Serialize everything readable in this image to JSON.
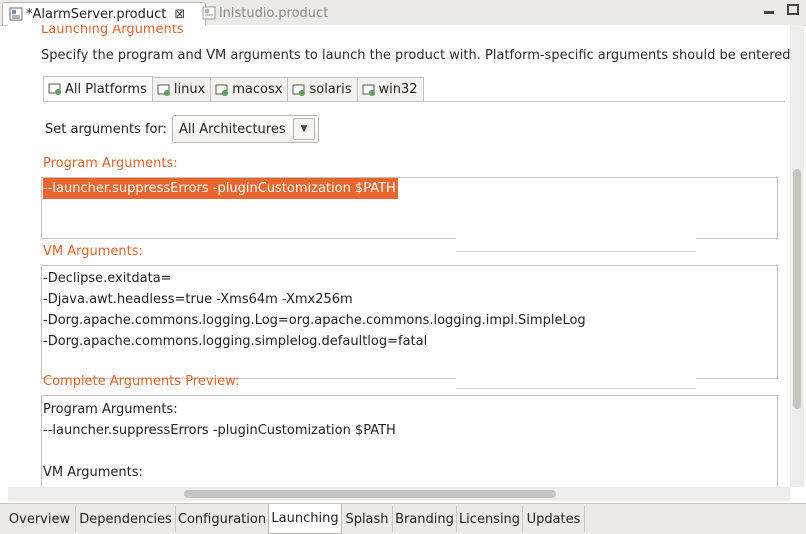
{
  "editor_tabs": [
    {
      "label": "*AlarmServer.product",
      "active": true
    },
    {
      "label": "lnlstudio.product",
      "active": false
    }
  ],
  "section": {
    "title": "Launching Arguments",
    "description": "Specify the program and VM arguments to launch the product with.  Platform-specific arguments should be entered"
  },
  "platform_tabs": [
    "All Platforms",
    "linux",
    "macosx",
    "solaris",
    "win32"
  ],
  "set_args": {
    "label": "Set arguments for:",
    "value": "All Architectures"
  },
  "program_args": {
    "label": "Program Arguments:",
    "lines": [
      "--launcher.suppressErrors -pluginCustomization $PATH"
    ]
  },
  "vm_args": {
    "label": "VM Arguments:",
    "lines": [
      "-Declipse.exitdata=",
      "-Djava.awt.headless=true -Xms64m -Xmx256m",
      "-Dorg.apache.commons.logging.Log=org.apache.commons.logging.impl.SimpleLog",
      "-Dorg.apache.commons.logging.simplelog.defaultlog=fatal"
    ]
  },
  "preview": {
    "label": "Complete Arguments Preview:",
    "lines": [
      "Program Arguments:",
      "--launcher.suppressErrors -pluginCustomization $PATH",
      "",
      "VM Arguments:"
    ]
  },
  "page_tabs": [
    {
      "label": "Overview"
    },
    {
      "label": "Dependencies"
    },
    {
      "label": "Configuration"
    },
    {
      "label": "Launching",
      "active": true
    },
    {
      "label": "Splash"
    },
    {
      "label": "Branding"
    },
    {
      "label": "Licensing"
    },
    {
      "label": "Updates"
    }
  ],
  "colors": {
    "accent": "#e0632b",
    "selection": "#e8662f"
  }
}
